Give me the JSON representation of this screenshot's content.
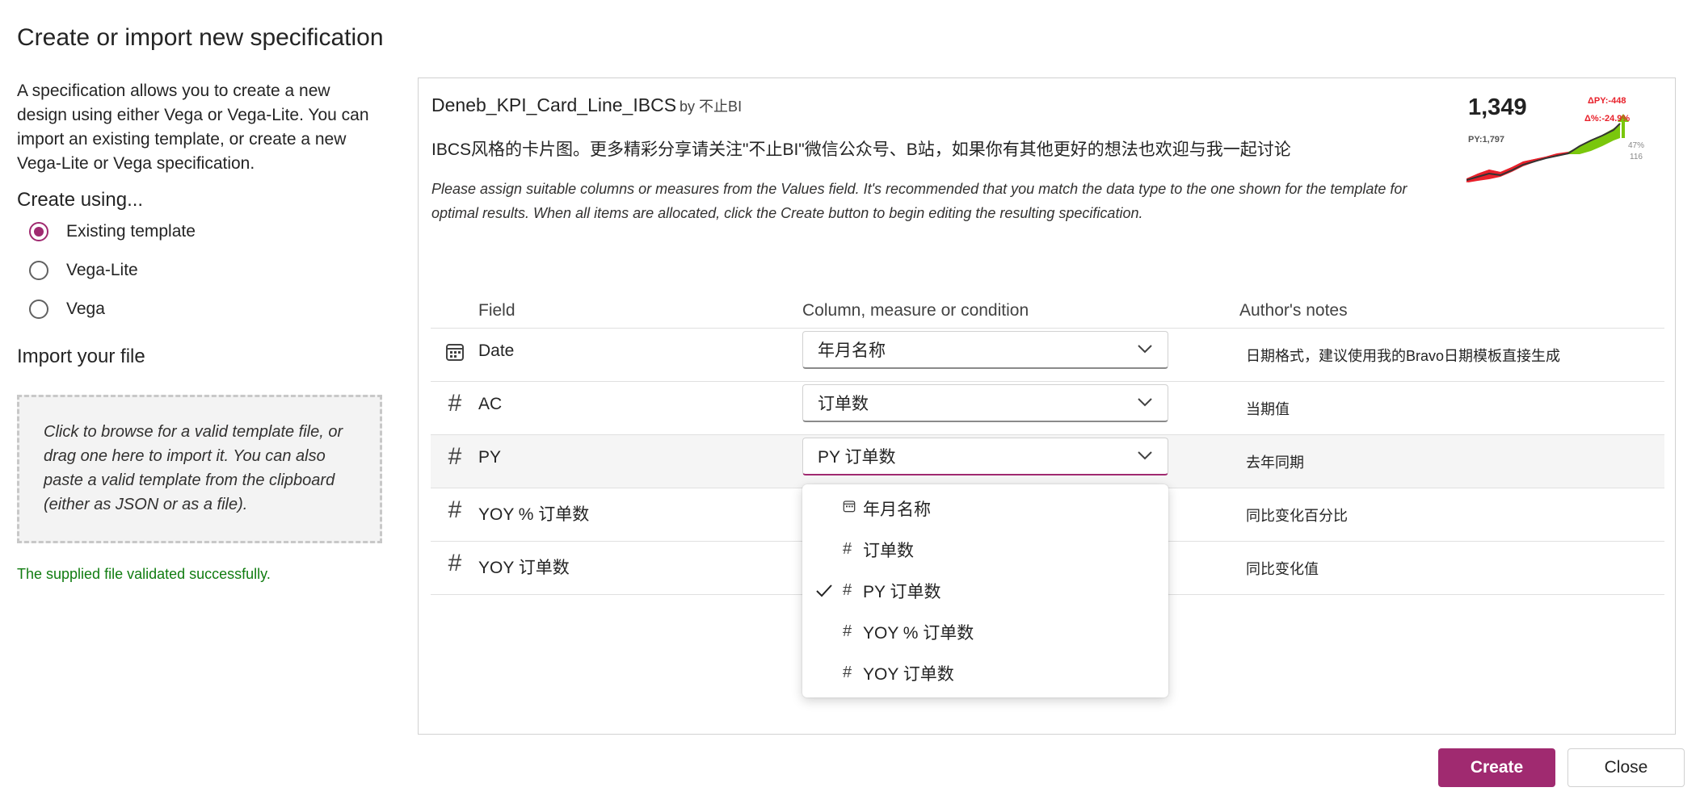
{
  "dialog": {
    "title": "Create or import new specification"
  },
  "left": {
    "intro": "A specification allows you to create a new design using either Vega or Vega-Lite. You can import an existing template, or create a new Vega-Lite or Vega specification.",
    "create_using_label": "Create using...",
    "options": [
      {
        "label": "Existing template",
        "checked": true
      },
      {
        "label": "Vega-Lite",
        "checked": false
      },
      {
        "label": "Vega",
        "checked": false
      }
    ],
    "import_label": "Import your file",
    "dropzone_text": "Click to browse for a valid template file, or drag one here to import it. You can also paste a valid template from the clipboard (either as JSON or as a file).",
    "validation_message": "The supplied file validated successfully.",
    "validation_color": "#107c10"
  },
  "template": {
    "name": "Deneb_KPI_Card_Line_IBCS",
    "by": "by 不止BI",
    "description": "IBCS风格的卡片图。更多精彩分享请关注\"不止BI\"微信公众号、B站，如果你有其他更好的想法也欢迎与我一起讨论",
    "instructions": "Please assign suitable columns or measures from the Values field. It's recommended that you match the data type to the one shown for the template for optimal results. When all items are allocated, click the Create button to begin editing the resulting specification.",
    "preview": {
      "value": "1,349",
      "py": "PY:1,797",
      "delta_py": "ΔPY:-448",
      "delta_pct": "Δ%:-24.9%",
      "pct_label": "47%",
      "small_label": "116"
    }
  },
  "table": {
    "headers": {
      "field": "Field",
      "column": "Column, measure or condition",
      "notes": "Author's notes"
    },
    "rows": [
      {
        "icon": "calendar-icon",
        "field": "Date",
        "value": "年月名称",
        "note": "日期格式，建议使用我的Bravo日期模板直接生成"
      },
      {
        "icon": "hash-icon",
        "field": "AC",
        "value": "订单数",
        "note": "当期值"
      },
      {
        "icon": "hash-icon",
        "field": "PY",
        "value": "PY 订单数",
        "note": "去年同期"
      },
      {
        "icon": "hash-icon",
        "field": "YOY % 订单数",
        "value": "",
        "note": "同比变化百分比"
      },
      {
        "icon": "hash-icon",
        "field": "YOY 订单数",
        "value": "",
        "note": "同比变化值"
      }
    ]
  },
  "dropdown_options": [
    {
      "icon": "calendar-icon",
      "label": "年月名称",
      "selected": false
    },
    {
      "icon": "hash-icon",
      "label": "订单数",
      "selected": false
    },
    {
      "icon": "hash-icon",
      "label": "PY 订单数",
      "selected": true
    },
    {
      "icon": "hash-icon",
      "label": "YOY % 订单数",
      "selected": false
    },
    {
      "icon": "hash-icon",
      "label": "YOY 订单数",
      "selected": false
    }
  ],
  "buttons": {
    "create": "Create",
    "close": "Close"
  },
  "colors": {
    "accent": "#a02a70",
    "negative": "#e8202a",
    "positive": "#7ac70c"
  }
}
